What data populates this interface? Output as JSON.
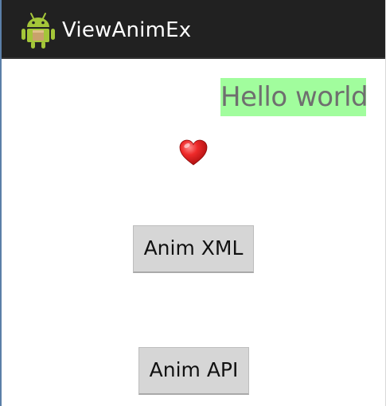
{
  "action_bar": {
    "title": "ViewAnimEx",
    "icon": "android-robot-icon"
  },
  "content": {
    "hello_text": "Hello world",
    "hello_background": "#a1fd9d",
    "heart_icon": "heart-icon",
    "anim_xml_label": "Anim XML",
    "anim_api_label": "Anim API"
  },
  "colors": {
    "action_bar": "#212121",
    "button": "#d6d6d6",
    "heart": "#e01b1b"
  }
}
